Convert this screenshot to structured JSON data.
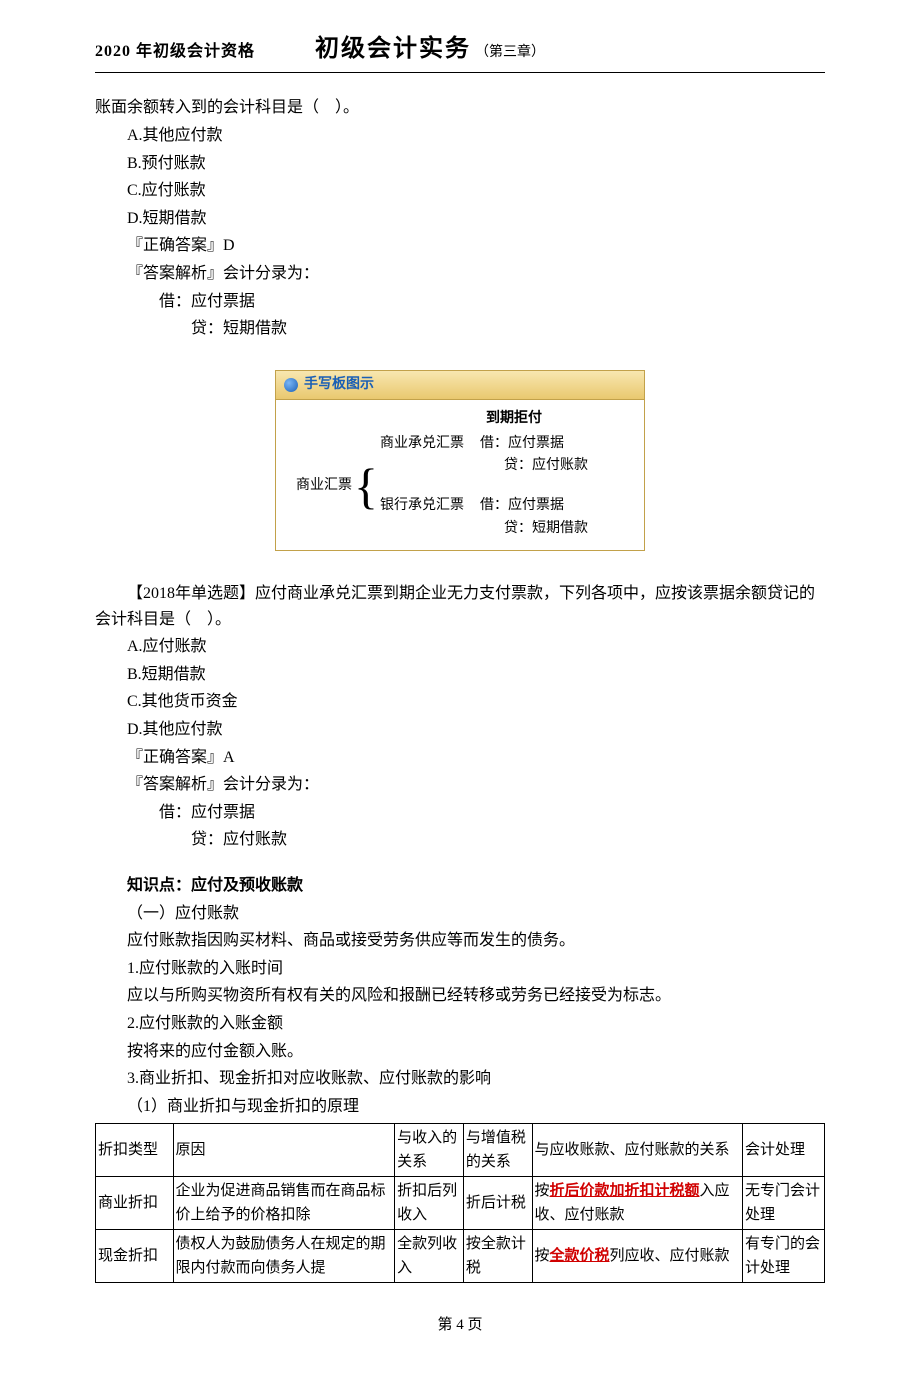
{
  "header": {
    "left": "2020 年初级会计资格",
    "mid": "初级会计实务",
    "right": "（第三章）"
  },
  "q1": {
    "stem": "账面余额转入到的会计科目是（　）。",
    "A": "A.其他应付款",
    "B": "B.预付账款",
    "C": "C.应付账款",
    "D": "D.短期借款",
    "answer_label": "『正确答案』D",
    "analysis_label": "『答案解析』会计分录为：",
    "entry1": "借：应付票据",
    "entry2": "贷：短期借款"
  },
  "diagram": {
    "title": "手写板图示",
    "top_right": "到期拒付",
    "root": "商业汇票",
    "branch1": "商业承兑汇票",
    "branch2": "银行承兑汇票",
    "b1_dr": "借：应付票据",
    "b1_cr": "贷：应付账款",
    "b2_dr": "借：应付票据",
    "b2_cr": "贷：短期借款"
  },
  "q2": {
    "stem_prefix": "【2018年单选题】应付商业承兑汇票到期企业无力支付票款，下列各项中，应按该票据余额贷记的会计科目是（　）。",
    "A": "A.应付账款",
    "B": "B.短期借款",
    "C": "C.其他货币资金",
    "D": "D.其他应付款",
    "answer_label": "『正确答案』A",
    "analysis_label": "『答案解析』会计分录为：",
    "entry1": "借：应付票据",
    "entry2": "贷：应付账款"
  },
  "kp": {
    "title": "知识点：应付及预收账款",
    "sec1": "（一）应付账款",
    "sec1_desc": "应付账款指因购买材料、商品或接受劳务供应等而发生的债务。",
    "p1": "1.应付账款的入账时间",
    "p1_desc": "应以与所购买物资所有权有关的风险和报酬已经转移或劳务已经接受为标志。",
    "p2": "2.应付账款的入账金额",
    "p2_desc": "按将来的应付金额入账。",
    "p3": "3.商业折扣、现金折扣对应收账款、应付账款的影响",
    "p3_sub": "（1）商业折扣与现金折扣的原理"
  },
  "table": {
    "h1": "折扣类型",
    "h2": "原因",
    "h3": "与收入的关系",
    "h4": "与增值税的关系",
    "h5": "与应收账款、应付账款的关系",
    "h6": "会计处理",
    "r1c1": "商业折扣",
    "r1c2": "企业为促进商品销售而在商品标价上给予的价格扣除",
    "r1c3": "折扣后列收入",
    "r1c4": "折后计税",
    "r1c5_pre": "按",
    "r1c5_red": "折后价款加折扣计税额",
    "r1c5_post": "入应收、应付账款",
    "r1c6": "无专门会计处理",
    "r2c1": "现金折扣",
    "r2c2": "债权人为鼓励债务人在规定的期限内付款而向债务人提",
    "r2c3": "全款列收入",
    "r2c4": "按全款计税",
    "r2c5_pre": "按",
    "r2c5_red": "全款价税",
    "r2c5_post": "列应收、应付账款",
    "r2c6": "有专门的会计处理"
  },
  "footer": "第 4 页"
}
